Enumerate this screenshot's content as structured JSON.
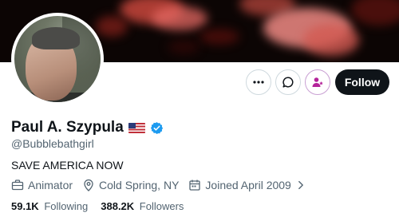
{
  "profile": {
    "display_name": "Paul A. Szypula",
    "handle": "@Bubblebathgirl",
    "bio": "SAVE AMERICA NOW",
    "profession": "Animator",
    "location": "Cold Spring, NY",
    "joined": "Joined April 2009",
    "following_count": "59.1K",
    "following_label": "Following",
    "followers_count": "388.2K",
    "followers_label": "Followers",
    "flag_icon": "us-flag-icon",
    "verified_icon": "verified-badge-icon"
  },
  "actions": {
    "follow_label": "Follow",
    "more_icon": "more-icon",
    "message_icon": "message-icon",
    "subscribe_icon": "subscribe-icon"
  },
  "colors": {
    "text_primary": "#0f1419",
    "text_secondary": "#536471",
    "verified_blue": "#1d9bf0",
    "follow_bg": "#0f1419",
    "subscribe_accent": "#b5249a"
  }
}
